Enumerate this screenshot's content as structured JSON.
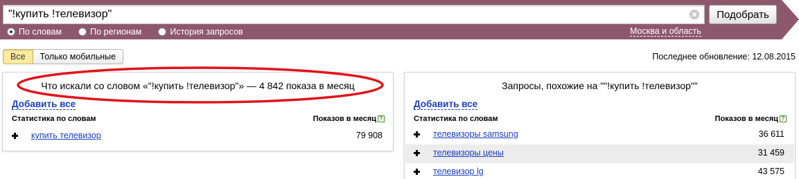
{
  "search": {
    "query": "\"!купить !телевизор\"",
    "button_label": "Подобрать",
    "modes": [
      {
        "label": "По словам",
        "selected": true
      },
      {
        "label": "По регионам",
        "selected": false
      },
      {
        "label": "История запросов",
        "selected": false
      }
    ],
    "region": "Москва и область",
    "band_color": "#8e586c"
  },
  "filters": {
    "tabs": [
      {
        "label": "Все",
        "active": true
      },
      {
        "label": "Только мобильные",
        "active": false
      }
    ],
    "last_update": "Последнее обновление: 12.08.2015"
  },
  "left_panel": {
    "title": "Что искали со словом «\"!купить !телевизор\"» — 4 842 показа в месяц",
    "add_all": "Добавить все",
    "col_stats": "Статистика по словам",
    "col_shows": "Показов в месяц",
    "help": "?",
    "rows": [
      {
        "phrase": "купить телевизор",
        "count": "79 908"
      }
    ]
  },
  "right_panel": {
    "title": "Запросы, похожие на \"\"!купить !телевизор\"\"",
    "add_all": "Добавить все",
    "col_stats": "Статистика по словам",
    "col_shows": "Показов в месяц",
    "help": "?",
    "rows": [
      {
        "phrase": "телевизоры samsung",
        "count": "36 611"
      },
      {
        "phrase": "телевизоры цены",
        "count": "31 459"
      },
      {
        "phrase": "телевизор lg",
        "count": "43 575"
      }
    ]
  },
  "colors": {
    "link": "#1a3dc1",
    "annotation": "#e0141c",
    "active_tab": "#ffeba0"
  }
}
